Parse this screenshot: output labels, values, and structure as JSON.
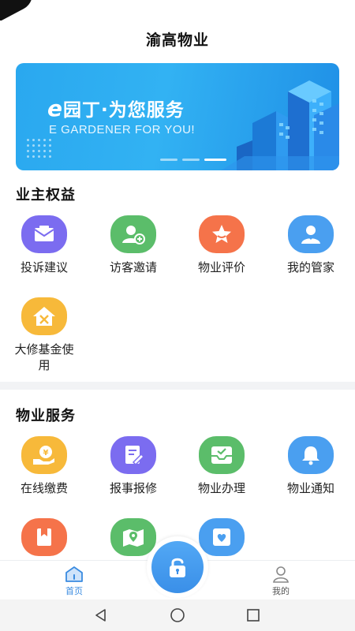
{
  "app": {
    "title": "渝高物业"
  },
  "banner": {
    "slogan_e": "e",
    "slogan_rest": "园丁·为您服务",
    "subtitle": "E GARDENER FOR YOU!",
    "slide_count": 3,
    "active_slide": 3
  },
  "owner_rights": {
    "title": "业主权益",
    "items": [
      {
        "label": "投诉建议",
        "icon": "mail-icon",
        "color": "#7b6cf0"
      },
      {
        "label": "访客邀请",
        "icon": "add-visitor-icon",
        "color": "#5bbd6a"
      },
      {
        "label": "物业评价",
        "icon": "star-icon",
        "color": "#f5734a"
      },
      {
        "label": "我的管家",
        "icon": "butler-icon",
        "color": "#4a9ff0"
      },
      {
        "label": "大修基金使用",
        "icon": "repair-fund-icon",
        "color": "#f7b93a"
      }
    ]
  },
  "property_services": {
    "title": "物业服务",
    "items": [
      {
        "label": "在线缴费",
        "icon": "payment-icon",
        "color": "#f7b93a"
      },
      {
        "label": "报事报修",
        "icon": "repair-report-icon",
        "color": "#7b6cf0"
      },
      {
        "label": "物业办理",
        "icon": "inbox-check-icon",
        "color": "#5bbd6a"
      },
      {
        "label": "物业通知",
        "icon": "bell-icon",
        "color": "#4a9ff0"
      },
      {
        "label": "",
        "icon": "bookmark-icon",
        "color": "#f5734a"
      },
      {
        "label": "",
        "icon": "map-pin-icon",
        "color": "#5bbd6a"
      },
      {
        "label": "",
        "icon": "heart-card-icon",
        "color": "#4a9ff0"
      }
    ]
  },
  "tabbar": {
    "home_label": "首页",
    "mine_label": "我的",
    "active_color": "#3a8be0"
  }
}
